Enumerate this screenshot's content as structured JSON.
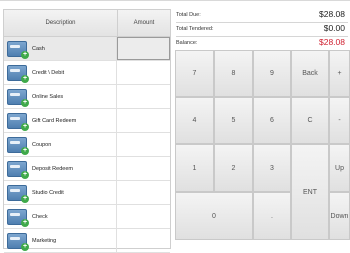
{
  "table": {
    "headers": {
      "description": "Description",
      "amount": "Amount"
    },
    "rows": [
      {
        "label": "Cash",
        "amount": "",
        "selected": true
      },
      {
        "label": "Credit \\ Debit",
        "amount": ""
      },
      {
        "label": "Online Sales",
        "amount": ""
      },
      {
        "label": "Gift Card Redeem",
        "amount": ""
      },
      {
        "label": "Coupon",
        "amount": ""
      },
      {
        "label": "Deposit Redeem",
        "amount": ""
      },
      {
        "label": "Studio Credit",
        "amount": ""
      },
      {
        "label": "Check",
        "amount": ""
      },
      {
        "label": "Marketing",
        "amount": ""
      }
    ]
  },
  "totals": {
    "total_due": {
      "label": "Total Due:",
      "value": "$28.08"
    },
    "total_tendered": {
      "label": "Total Tendered:",
      "value": "$0.00"
    },
    "balance": {
      "label": "Balance:",
      "value": "$28.08",
      "color": "#d02030"
    }
  },
  "keypad": {
    "k7": "7",
    "k8": "8",
    "k9": "9",
    "back": "Back",
    "plus": "+",
    "k4": "4",
    "k5": "5",
    "k6": "6",
    "clear": "C",
    "minus": "-",
    "k1": "1",
    "k2": "2",
    "k3": "3",
    "up": "Up",
    "k0": "0",
    "dot": ".",
    "ent": "ENT",
    "down": "Down"
  },
  "icons": {
    "payment_type": "payment-card-add-icon"
  }
}
